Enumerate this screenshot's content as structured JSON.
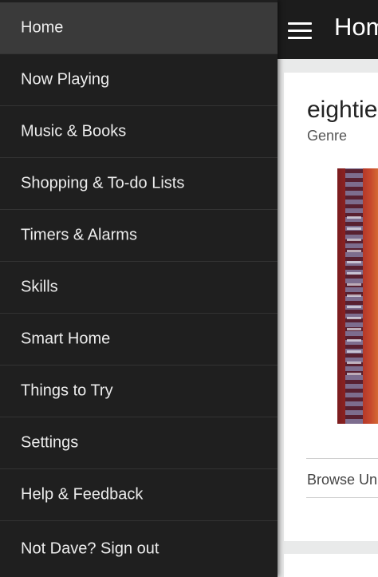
{
  "header": {
    "title": "Home",
    "menu_icon": "hamburger-menu-icon"
  },
  "drawer": {
    "items": [
      {
        "label": "Home",
        "active": true
      },
      {
        "label": "Now Playing"
      },
      {
        "label": "Music & Books"
      },
      {
        "label": "Shopping & To-do Lists"
      },
      {
        "label": "Timers & Alarms"
      },
      {
        "label": "Skills"
      },
      {
        "label": "Smart Home"
      },
      {
        "label": "Things to Try"
      },
      {
        "label": "Settings"
      },
      {
        "label": "Help & Feedback"
      },
      {
        "label": "Not Dave? Sign out"
      }
    ]
  },
  "card": {
    "title": "eightie",
    "subtitle": "Genre",
    "link_label": "Browse Un"
  },
  "colors": {
    "drawer_bg": "#1f1f1f",
    "drawer_active_bg": "#3a3a3a",
    "topbar_bg": "#1c1c1c",
    "main_bg": "#e9eaea"
  }
}
